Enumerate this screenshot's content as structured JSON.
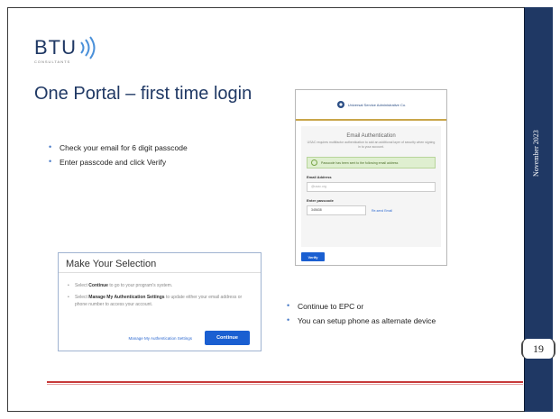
{
  "slide": {
    "title": "One Portal – first time login",
    "date": "November 2023",
    "page_number": "19"
  },
  "logo": {
    "text": "BTU",
    "subtitle": "CONSULTANTS"
  },
  "bullets_left": [
    "Check your email for 6 digit passcode",
    "Enter passcode and click Verify"
  ],
  "bullets_right": [
    "Continue to EPC or",
    "You can setup phone as alternate device"
  ],
  "email_auth": {
    "org_name": "Universal Service Administrative Co.",
    "title": "Email Authentication",
    "description": "USAC requires multifactor authentication to add an additional layer of security when signing in to your account.",
    "alert": "Passcode has been sent to the following email address",
    "email_label": "Email Address",
    "email_value": "@usac.org",
    "passcode_label": "Enter passcode",
    "passcode_value": "345638",
    "resend_label": "Re-send Email",
    "verify_label": "Verify"
  },
  "selection": {
    "title": "Make Your Selection",
    "item1_prefix": "Select ",
    "item1_bold": "Continue",
    "item1_suffix": " to go to your program's system.",
    "item2_prefix": "Select ",
    "item2_bold": "Manage My Authentication Settings",
    "item2_suffix": " to update either your email address or phone number to access your account.",
    "manage_link": "Manage My Authentication Settings",
    "continue_label": "Continue"
  },
  "colors": {
    "navy": "#1f3864",
    "accent_red": "#c73a3a",
    "button_blue": "#1a5fd1"
  }
}
